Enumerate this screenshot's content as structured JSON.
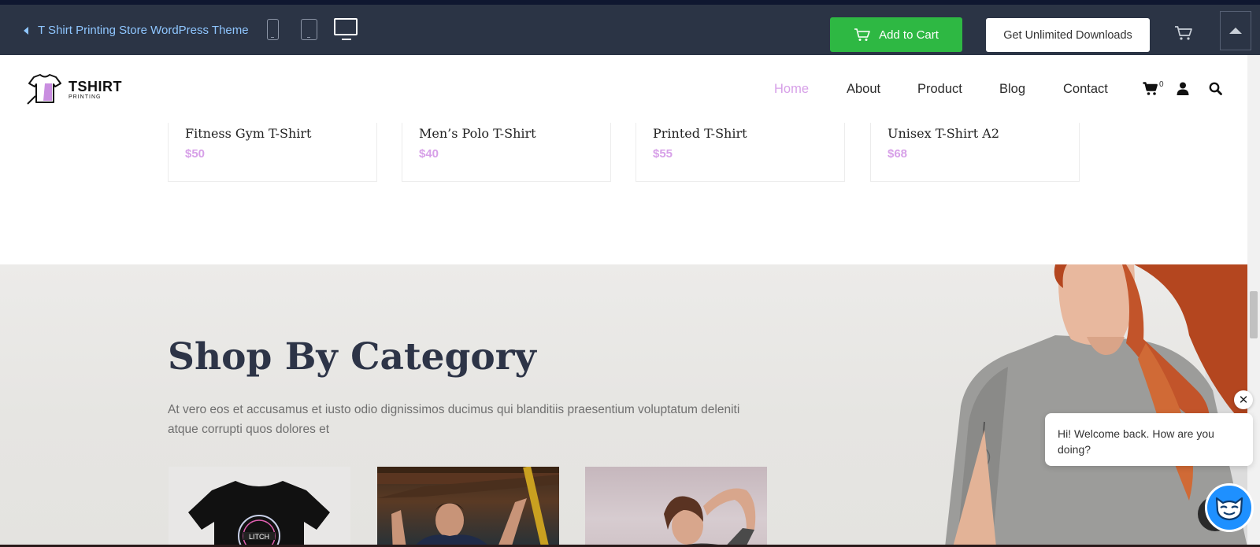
{
  "topbar": {
    "back_label": "T Shirt Printing Store WordPress Theme",
    "add_to_cart_label": "Add to Cart",
    "unlimited_label": "Get Unlimited Downloads",
    "icons": [
      "phone-icon",
      "tablet-icon",
      "desktop-icon",
      "cart-icon",
      "arrow-up-icon"
    ],
    "accent_green": "#2eb843"
  },
  "header": {
    "logo_title": "TSHIRT",
    "logo_subtitle": "PRINTING",
    "nav": [
      {
        "label": "Home",
        "active": true
      },
      {
        "label": "About",
        "active": false
      },
      {
        "label": "Product",
        "active": false
      },
      {
        "label": "Blog",
        "active": false
      },
      {
        "label": "Contact",
        "active": false
      }
    ],
    "cart_count": "0",
    "accent_color": "#d7a0e8"
  },
  "products": [
    {
      "title": "Fitness Gym T-Shirt",
      "price": "$50"
    },
    {
      "title": "Men’s Polo T-Shirt",
      "price": "$40"
    },
    {
      "title": "Printed T-Shirt",
      "price": "$55"
    },
    {
      "title": "Unisex T-Shirt A2",
      "price": "$68"
    }
  ],
  "category": {
    "title": "Shop By Category",
    "description": "At vero eos et accusamus et iusto odio dignissimos ducimus qui blanditiis praesentium voluptatum deleniti atque corrupti quos dolores et",
    "shirt_print": "LITCH"
  },
  "chat": {
    "message": "Hi! Welcome back. How are you doing?"
  }
}
